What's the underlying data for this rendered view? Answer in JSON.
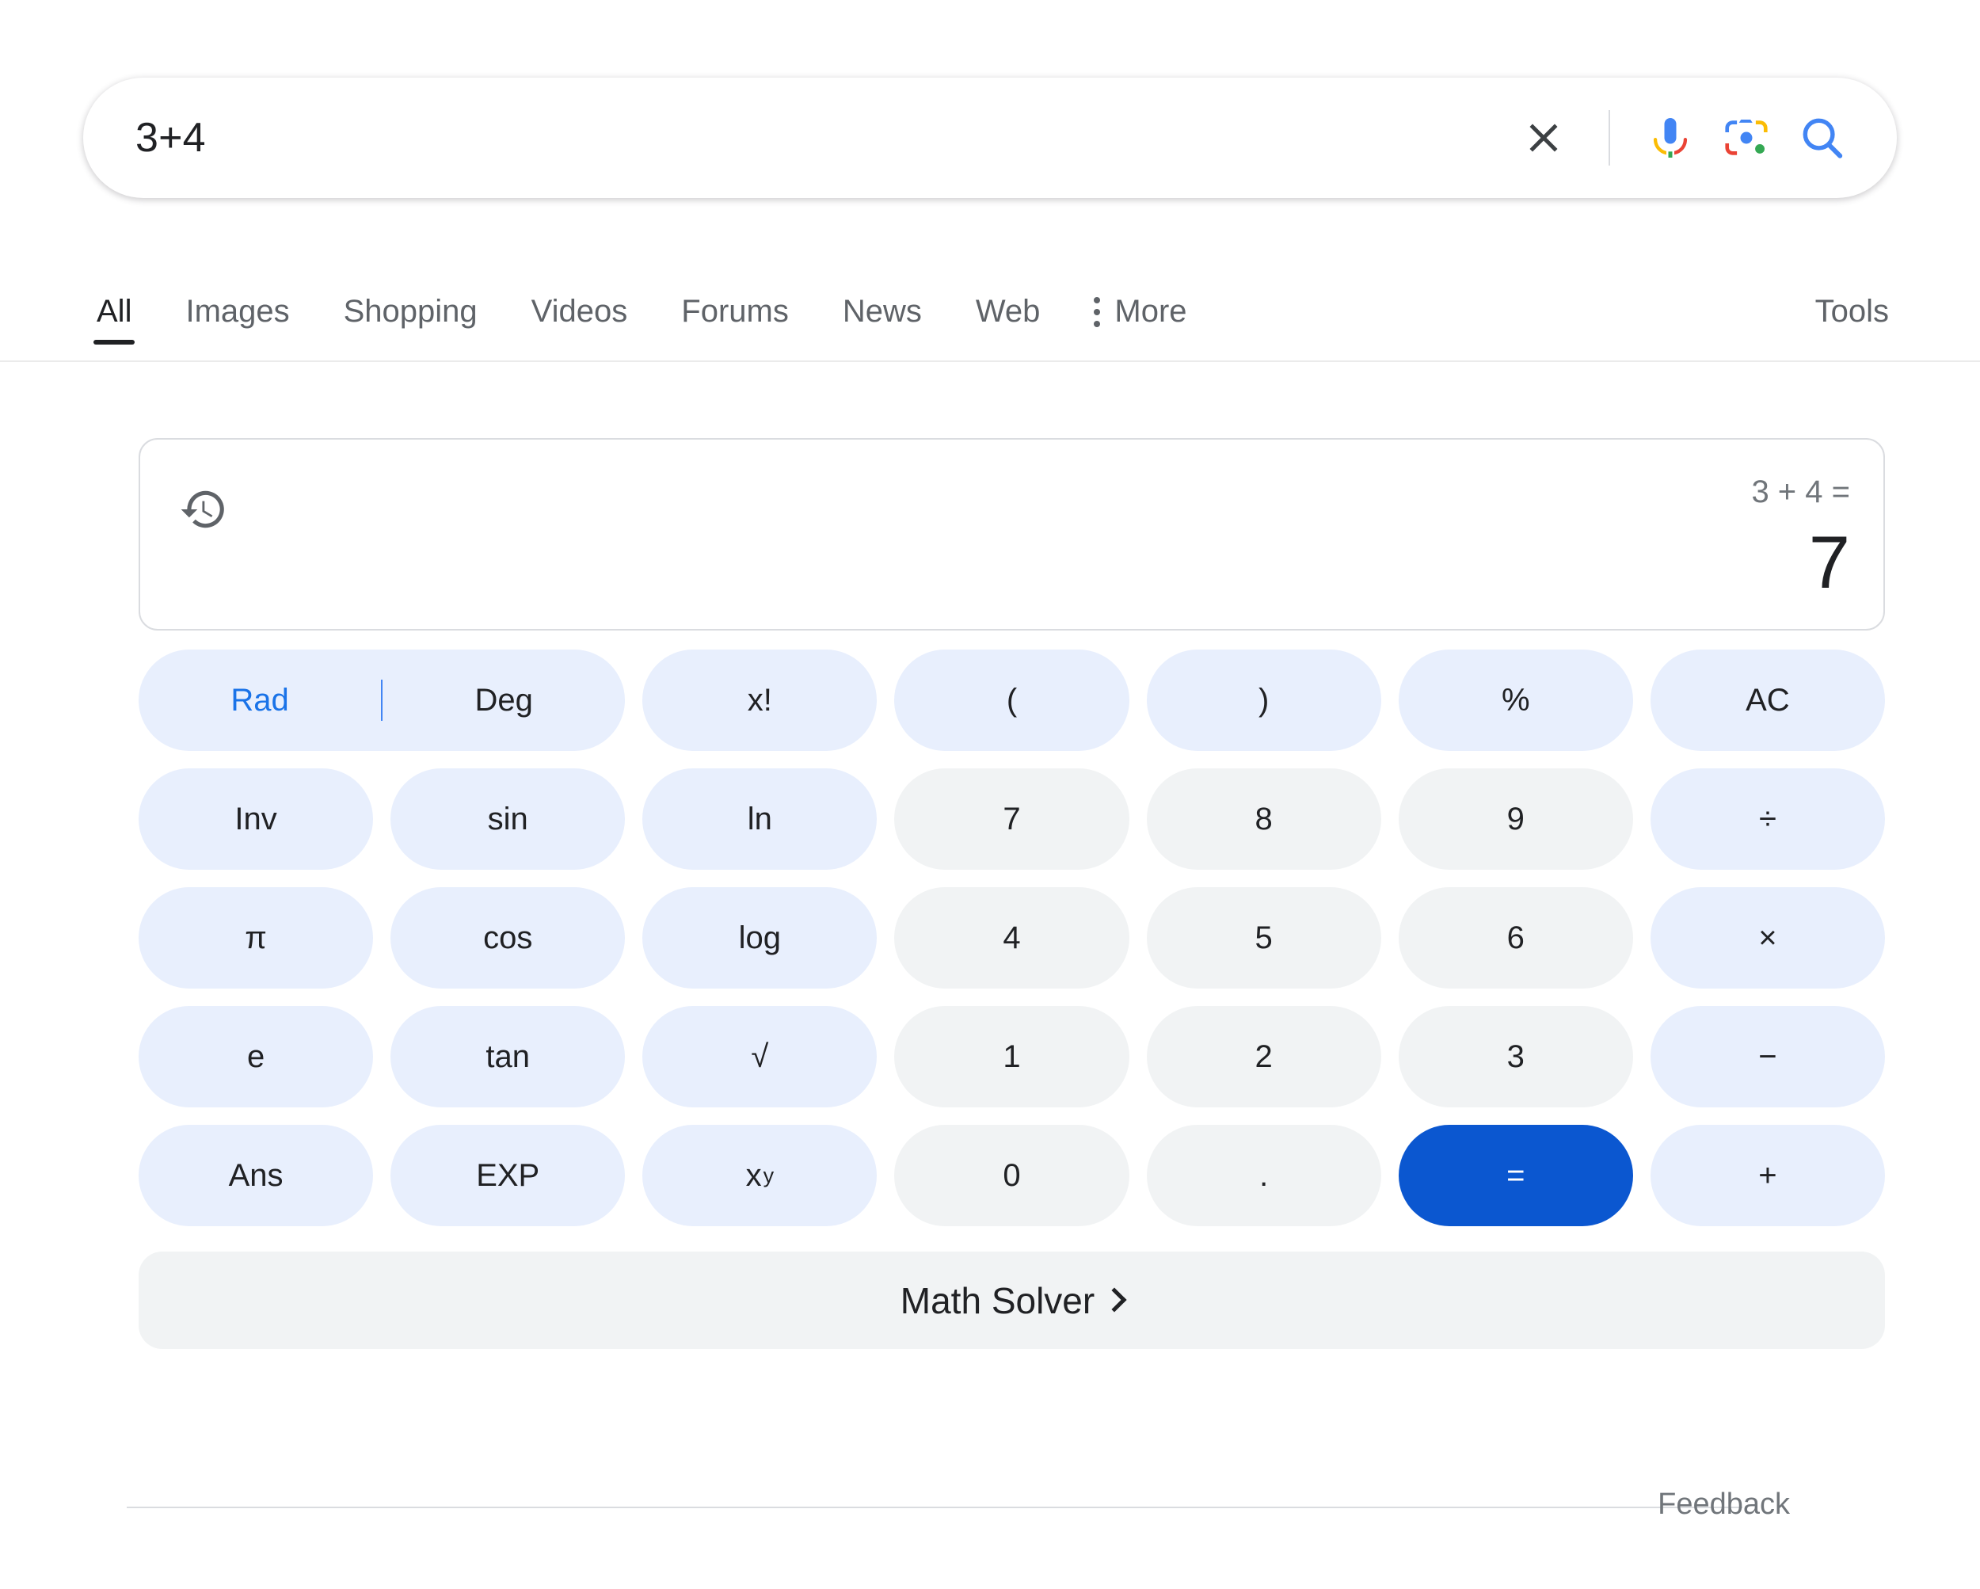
{
  "search": {
    "query": "3+4",
    "placeholder": "Search",
    "clear_label": "Clear",
    "voice_label": "Search by voice",
    "lens_label": "Search by image",
    "submit_label": "Google Search"
  },
  "tabs": {
    "items": [
      {
        "label": "All",
        "active": true
      },
      {
        "label": "Images",
        "active": false
      },
      {
        "label": "Shopping",
        "active": false
      },
      {
        "label": "Videos",
        "active": false
      },
      {
        "label": "Forums",
        "active": false
      },
      {
        "label": "News",
        "active": false
      },
      {
        "label": "Web",
        "active": false
      },
      {
        "label": "More",
        "active": false
      }
    ],
    "tools_label": "Tools"
  },
  "calculator": {
    "history_icon": "history-icon",
    "expression": "3 + 4 =",
    "result": "7",
    "angle_mode": {
      "rad": "Rad",
      "deg": "Deg",
      "selected": "Rad"
    },
    "keys": {
      "factorial": "x!",
      "paren_open": "(",
      "paren_close": ")",
      "percent": "%",
      "all_clear": "AC",
      "inverse": "Inv",
      "sin": "sin",
      "ln": "ln",
      "seven": "7",
      "eight": "8",
      "nine": "9",
      "divide": "÷",
      "pi": "π",
      "cos": "cos",
      "log": "log",
      "four": "4",
      "five": "5",
      "six": "6",
      "multiply": "×",
      "e": "e",
      "tan": "tan",
      "sqrt": "√",
      "one": "1",
      "two": "2",
      "three": "3",
      "minus": "−",
      "ans": "Ans",
      "exp": "EXP",
      "power_base": "x",
      "power_exp": "y",
      "zero": "0",
      "decimal": ".",
      "equals": "=",
      "plus": "+"
    },
    "math_solver_label": "Math Solver"
  },
  "footer": {
    "feedback_label": "Feedback"
  },
  "colors": {
    "accent_blue": "#0b57d0",
    "link_blue": "#1a73e8",
    "fn_key_bg": "#e8effd",
    "num_key_bg": "#f1f3f4",
    "text_primary": "#202124",
    "text_secondary": "#5f6368"
  }
}
